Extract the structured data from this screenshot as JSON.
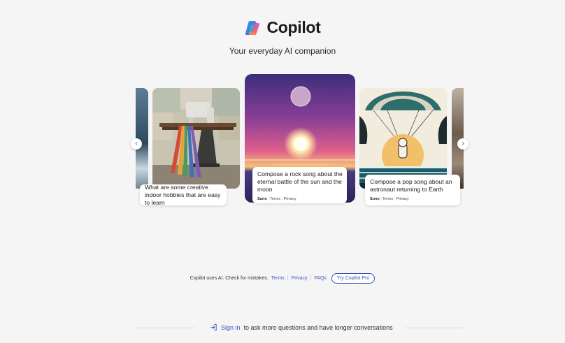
{
  "brand": {
    "title": "Copilot",
    "subtitle": "Your everyday AI companion"
  },
  "carousel": {
    "cards": [
      {
        "prompt": "What are some creative indoor hobbies that are easy to learn",
        "image": "sewing-machine-image"
      },
      {
        "prompt": "Compose a rock song about the eternal battle of the sun and the moon",
        "provider": "Suno",
        "terms": "Terms",
        "privacy": "Privacy",
        "image": "sun-moon-seascape-image"
      },
      {
        "prompt": "Compose a pop song about an astronaut returning to Earth",
        "provider": "Suno",
        "terms": "Terms",
        "privacy": "Privacy",
        "image": "astronaut-parachute-image"
      }
    ],
    "prev_icon": "chevron-left-icon",
    "next_icon": "chevron-right-icon"
  },
  "footer": {
    "notice": "Copilot uses AI. Check for mistakes.",
    "terms": "Terms",
    "privacy": "Privacy",
    "faqs": "FAQs",
    "try_pro": "Try Copilot Pro"
  },
  "signin": {
    "link": "Sign in",
    "rest": "to ask more questions and have longer conversations",
    "icon": "sign-in-icon"
  },
  "colors": {
    "background": "#f5f5f5",
    "link": "#3a52b8"
  }
}
